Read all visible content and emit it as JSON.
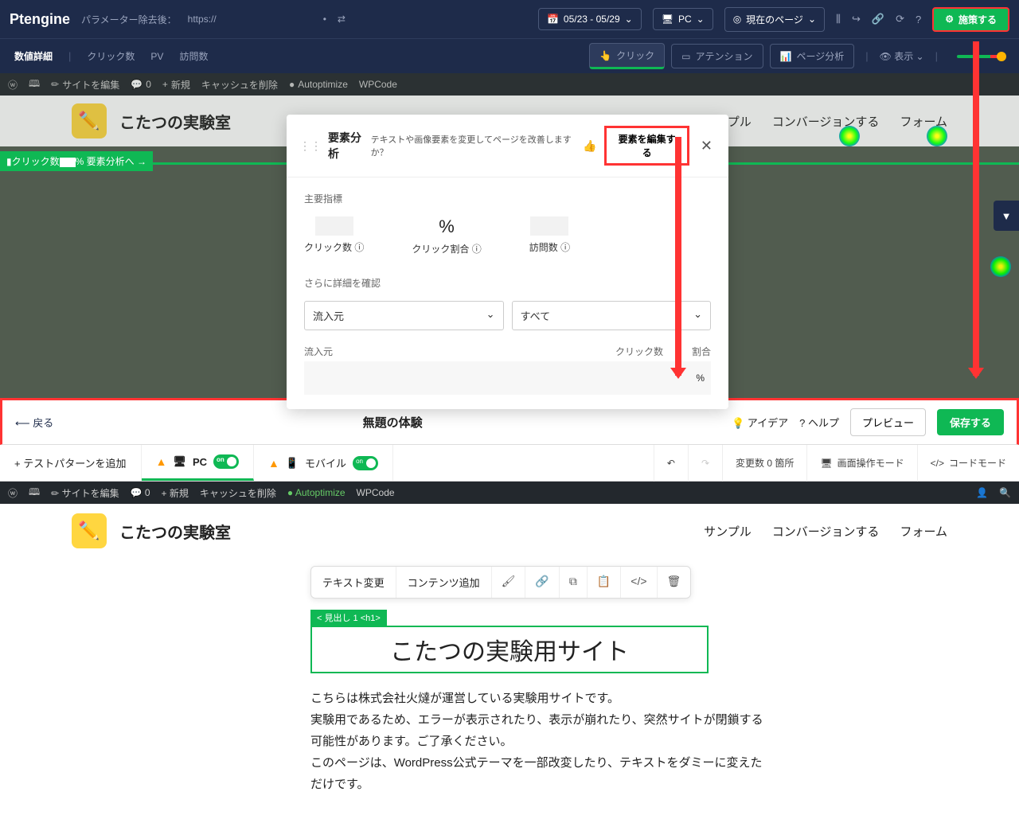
{
  "top": {
    "logo": "Ptengine",
    "url_prefix": "パラメーター除去後：",
    "url": "https://",
    "swap": "⇄",
    "date": "05/23 - 05/29",
    "device": "PC",
    "page_scope": "現在のページ",
    "action": "施策する"
  },
  "subbar": {
    "detail": "数値詳細",
    "items": [
      "クリック数",
      "PV",
      "訪問数"
    ],
    "tabs": {
      "click": "クリック",
      "attention": "アテンション",
      "analysis": "ページ分析"
    },
    "display": "表示"
  },
  "wp": {
    "edit": "サイトを編集",
    "comments": "0",
    "new": "新規",
    "cache": "キャッシュを削除",
    "auto": "Autoptimize",
    "wpcode": "WPCode"
  },
  "site": {
    "title": "こたつの実験室",
    "nav": [
      "サンプル",
      "コンバージョンする",
      "フォーム"
    ]
  },
  "click_badge": {
    "label": "クリック数",
    "suffix": "% 要素分析へ →"
  },
  "modal": {
    "title": "要素分析",
    "question": "テキストや画像要素を変更してページを改善しますか？",
    "edit_btn": "要素を編集する",
    "sec1": "主要指標",
    "m_pct": "%",
    "m1": "クリック数",
    "m2": "クリック割合",
    "m3": "訪問数",
    "sec2": "さらに詳細を確認",
    "sel1": "流入元",
    "sel2": "すべて",
    "th1": "流入元",
    "th2": "クリック数",
    "th3": "割合",
    "row_pct": "%"
  },
  "editor": {
    "back": "戻る",
    "title": "無題の体験",
    "idea": "アイデア",
    "help": "ヘルプ",
    "preview": "プレビュー",
    "save": "保存する",
    "add_pattern": "+ テストパターンを追加",
    "pc": "PC",
    "mobile": "モバイル",
    "changes": "変更数 0 箇所",
    "screen_mode": "画面操作モード",
    "code_mode": "コードモード"
  },
  "canvas": {
    "toolbar": {
      "text": "テキスト変更",
      "content": "コンテンツ追加"
    },
    "h1_tag": "< 見出し 1 <h1>",
    "h1": "こたつの実験用サイト",
    "body": "こちらは株式会社火燵が運営している実験用サイトです。\n実験用であるため、エラーが表示されたり、表示が崩れたり、突然サイトが閉鎖する可能性があります。ご了承ください。\nこのページは、WordPress公式テーマを一部改変したり、テキストをダミーに変えただけです。"
  }
}
